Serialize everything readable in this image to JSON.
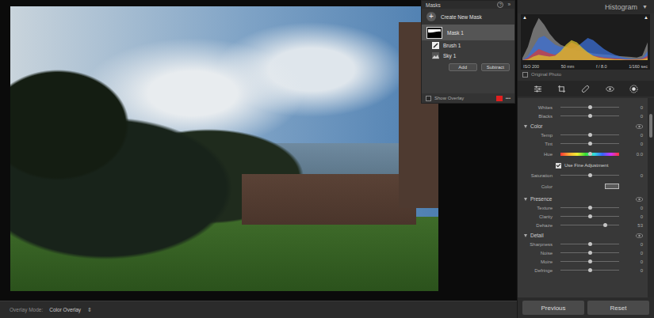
{
  "overlay_mode": {
    "label": "Overlay Mode:",
    "value": "Color Overlay",
    "toggle": "⇕"
  },
  "masks_panel": {
    "title": "Masks",
    "help_icon": "?",
    "collapse_icon": "»",
    "create_icon": "+",
    "create_label": "Create New Mask",
    "masks": [
      {
        "name": "Mask 1",
        "selected": true,
        "components": [
          {
            "name": "Brush 1",
            "kind": "brush",
            "selected": false
          },
          {
            "name": "Sky 1",
            "kind": "sky",
            "selected": false
          }
        ]
      }
    ],
    "buttons": [
      "Add",
      "Subtract"
    ],
    "show_overlay": {
      "label": "Show Overlay",
      "checked": false,
      "color": "#e01f1f"
    },
    "more": "•••"
  },
  "histogram": {
    "title": "Histogram",
    "toggle": "▼",
    "clip_indicators": [
      "▲",
      "▲"
    ],
    "series": [
      {
        "name": "luminance",
        "color": "#8c8c8c",
        "values": [
          5,
          30,
          70,
          95,
          80,
          60,
          45,
          35,
          30,
          25,
          22,
          20,
          18,
          15,
          14,
          13,
          12,
          10,
          9,
          8,
          7,
          6,
          10,
          40
        ]
      },
      {
        "name": "blue",
        "color": "#3b6fd6",
        "values": [
          0,
          10,
          30,
          50,
          55,
          45,
          35,
          30,
          28,
          26,
          30,
          40,
          50,
          45,
          35,
          25,
          18,
          12,
          8,
          5,
          3,
          2,
          4,
          20
        ]
      },
      {
        "name": "red",
        "color": "#d23c3c",
        "values": [
          0,
          5,
          15,
          25,
          20,
          15,
          12,
          18,
          30,
          40,
          35,
          25,
          15,
          10,
          8,
          6,
          5,
          4,
          3,
          2,
          2,
          2,
          3,
          10
        ]
      },
      {
        "name": "yellow",
        "color": "#d9c22e",
        "values": [
          0,
          2,
          8,
          12,
          10,
          8,
          10,
          20,
          35,
          45,
          40,
          28,
          18,
          10,
          6,
          4,
          3,
          2,
          2,
          1,
          1,
          1,
          2,
          5
        ]
      }
    ],
    "info": [
      "ISO 200",
      "50 mm",
      "f / 8.0",
      "1/160 sec"
    ],
    "original_photo": {
      "label": "Original Photo",
      "checked": false
    }
  },
  "top_rows": [
    {
      "kind": "slider",
      "label": "Whites",
      "reading": "0",
      "level": 0.5
    },
    {
      "kind": "slider",
      "label": "Blacks",
      "reading": "0",
      "level": 0.5
    }
  ],
  "sections": [
    {
      "title": "Color",
      "expanded": true,
      "visible": true,
      "rows": [
        {
          "kind": "slider",
          "label": "Temp",
          "reading": "0",
          "level": 0.5
        },
        {
          "kind": "slider",
          "label": "Tint",
          "reading": "0",
          "level": 0.5
        },
        {
          "kind": "hue",
          "label": "Hue",
          "reading": "0.0",
          "level": 0.5
        },
        {
          "kind": "checkbox",
          "label": "Use Fine Adjustment",
          "checked": true
        },
        {
          "kind": "slider",
          "label": "Saturation",
          "reading": "0",
          "level": 0.5
        },
        {
          "kind": "swatch",
          "label": "Color"
        }
      ]
    },
    {
      "title": "Presence",
      "expanded": true,
      "visible": true,
      "rows": [
        {
          "kind": "slider",
          "label": "Texture",
          "reading": "0",
          "level": 0.5
        },
        {
          "kind": "slider",
          "label": "Clarity",
          "reading": "0",
          "level": 0.5
        },
        {
          "kind": "slider",
          "label": "Dehaze",
          "reading": "53",
          "level": 0.765
        }
      ]
    },
    {
      "title": "Detail",
      "expanded": true,
      "visible": true,
      "rows": [
        {
          "kind": "slider",
          "label": "Sharpness",
          "reading": "0",
          "level": 0.5
        },
        {
          "kind": "slider",
          "label": "Noise",
          "reading": "0",
          "level": 0.5
        },
        {
          "kind": "slider",
          "label": "Moire",
          "reading": "0",
          "level": 0.5
        },
        {
          "kind": "slider",
          "label": "Defringe",
          "reading": "0",
          "level": 0.5
        }
      ]
    }
  ],
  "buttons": [
    "Previous",
    "Reset"
  ]
}
